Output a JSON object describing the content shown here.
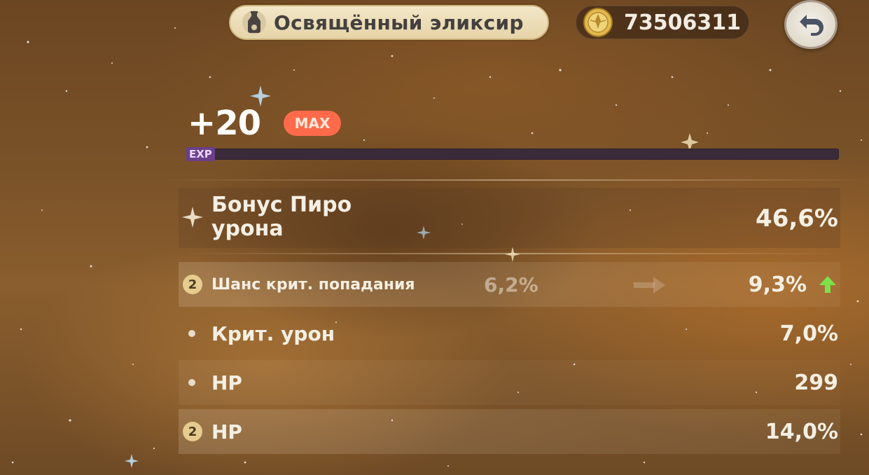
{
  "item": {
    "name": "Освящённый эликсир",
    "icon": "elixir-bottle-icon"
  },
  "currency": {
    "amount": "73506311",
    "icon": "mora-coin-icon"
  },
  "back_icon": "back-arrow-icon",
  "level": {
    "text": "+20",
    "max_label": "MAX",
    "exp_label": "EXP"
  },
  "main_stat": {
    "name": "Бонус Пиро урона",
    "value": "46,6%"
  },
  "substats": [
    {
      "marker": "2",
      "label": "Шанс крит. попадания",
      "old_value": "6,2%",
      "value": "9,3%",
      "increased": true
    },
    {
      "marker": "dot",
      "label": "Крит. урон",
      "value": "7,0%"
    },
    {
      "marker": "dot",
      "label": "HP",
      "value": "299"
    },
    {
      "marker": "2",
      "label": "HP",
      "value": "14,0%"
    }
  ],
  "colors": {
    "max_badge": "#ff6a4a",
    "up_arrow": "#7ee04a",
    "pill": "#efe2c2"
  }
}
